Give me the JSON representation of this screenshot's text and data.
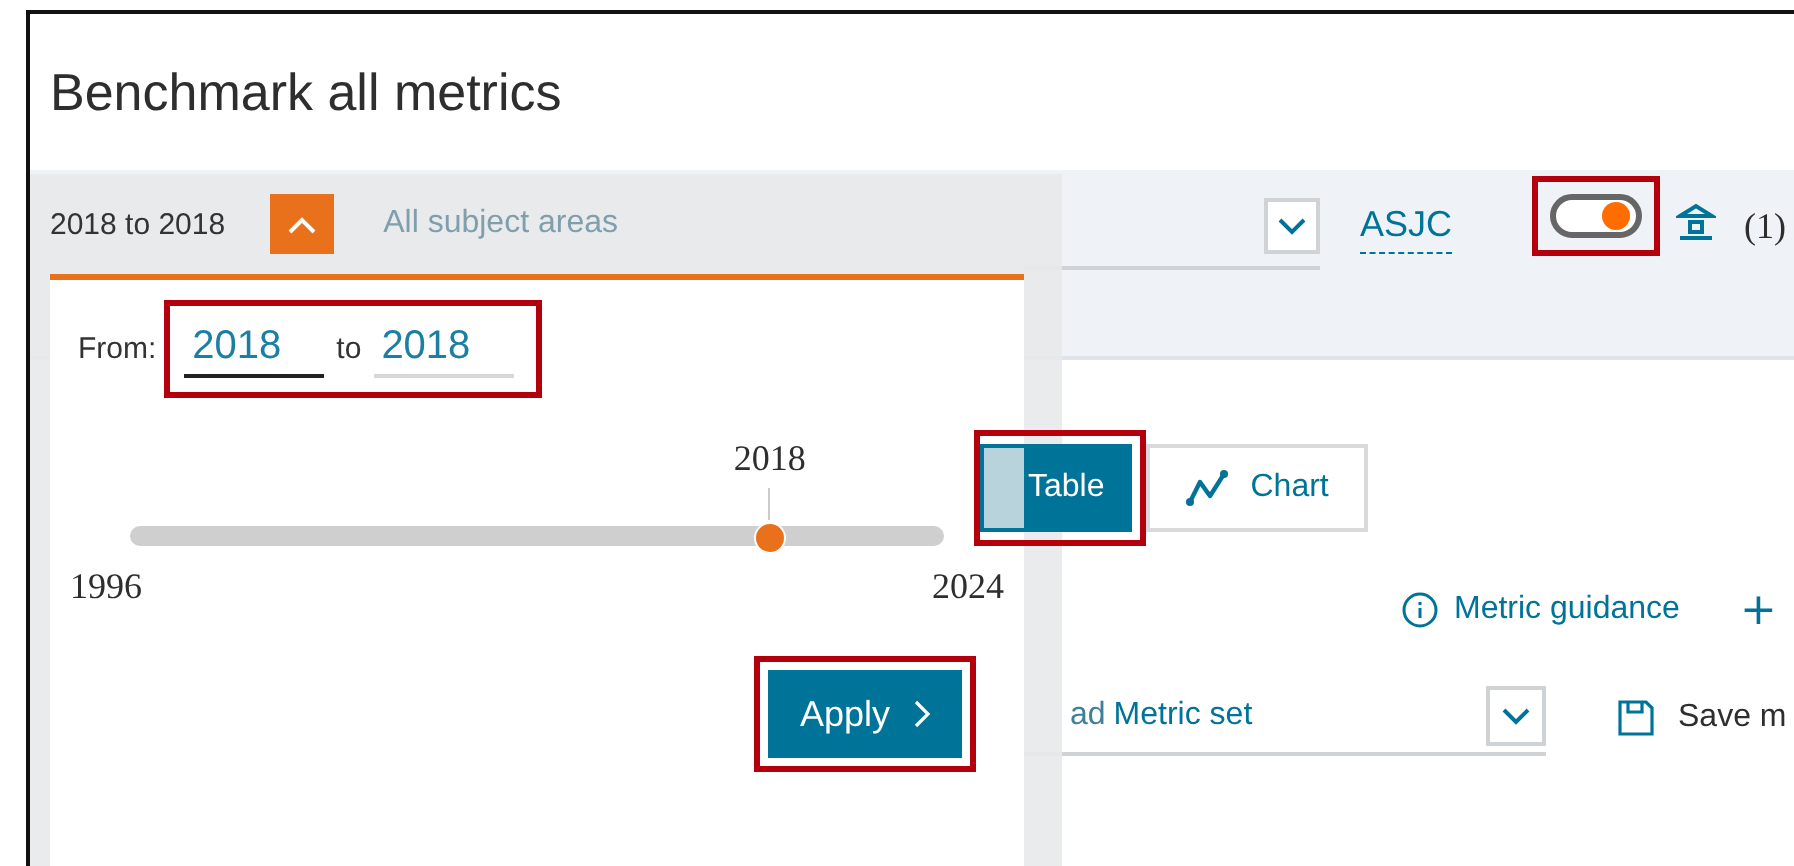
{
  "title": "Benchmark all metrics",
  "filters": {
    "year_range": {
      "value": "2018 to 2018",
      "expanded": true
    },
    "subject_field": {
      "placeholder": "All subject areas"
    },
    "classification_link": "ASJC",
    "toggle": {
      "on": true,
      "highlighted": true
    },
    "institution_count": "(1)"
  },
  "year_picker": {
    "from_label": "From:",
    "from_value": "2018",
    "to_label": "to",
    "to_value": "2018",
    "fields_highlighted": true,
    "slider": {
      "current": "2018",
      "level": 0.786,
      "min": "1996",
      "max": "2024"
    },
    "apply": {
      "label": "Apply",
      "highlighted": true
    }
  },
  "view_buttons": [
    {
      "label": "Table",
      "selected": true,
      "highlighted": true
    },
    {
      "label": "Chart",
      "selected": false,
      "highlighted": false
    }
  ],
  "metric_guidance": "Metric guidance",
  "add_label": "+",
  "metric_set": {
    "prefix": "ad",
    "label": "Metric set"
  },
  "save_label": "Save m"
}
